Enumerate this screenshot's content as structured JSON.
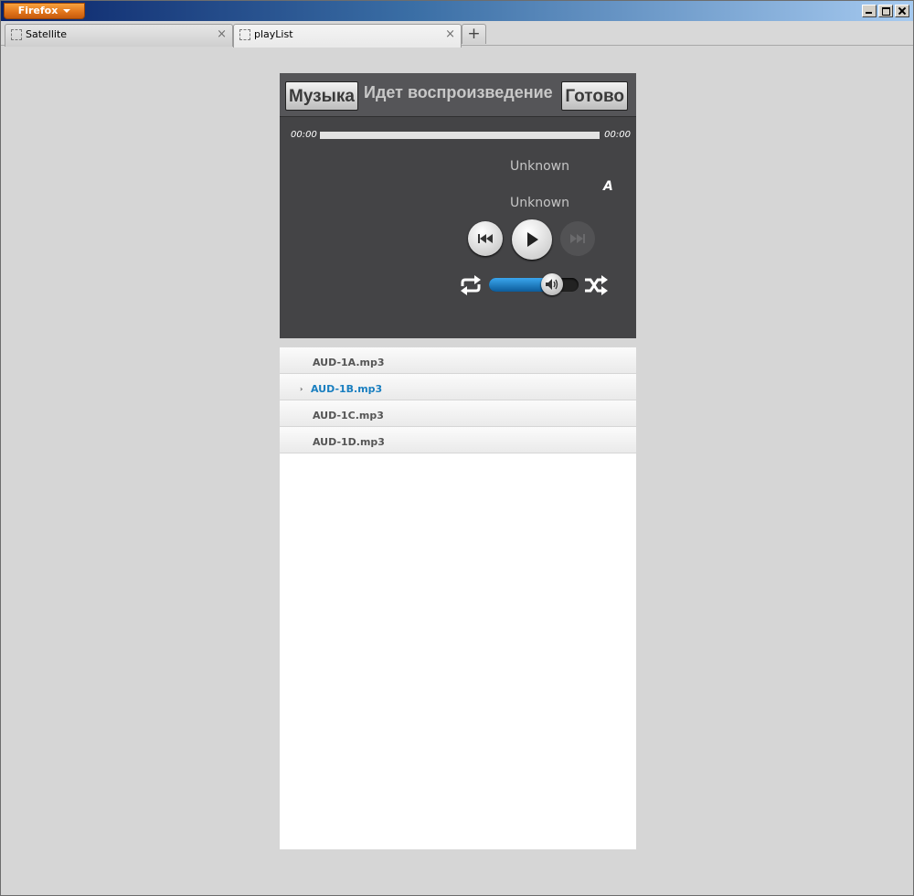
{
  "browser": {
    "menu_label": "Firefox",
    "tabs": [
      {
        "title": "Satellite",
        "close": "×"
      },
      {
        "title": "playList",
        "close": "×"
      }
    ],
    "new_tab": "+"
  },
  "player": {
    "header": {
      "back_label": "Музыка",
      "title": "Идет воспроизведение",
      "done_label": "Готово"
    },
    "time_elapsed": "00:00",
    "time_total": "00:00",
    "progress": 0,
    "track_title": "Unknown",
    "track_artist": "Unknown",
    "mode_letter": "A",
    "volume": 0.7,
    "controls": [
      "prev-icon",
      "play-icon",
      "next-icon",
      "repeat-icon",
      "shuffle-icon",
      "speaker-icon"
    ],
    "colors": {
      "background": "#444446",
      "accent": "#1a7fc0",
      "disabled": "#525254"
    }
  },
  "playlist": {
    "items": [
      {
        "name": "AUD-1A.mp3",
        "current": false
      },
      {
        "name": "AUD-1B.mp3",
        "current": true
      },
      {
        "name": "AUD-1C.mp3",
        "current": false
      },
      {
        "name": "AUD-1D.mp3",
        "current": false
      }
    ],
    "current_marker": "›"
  }
}
